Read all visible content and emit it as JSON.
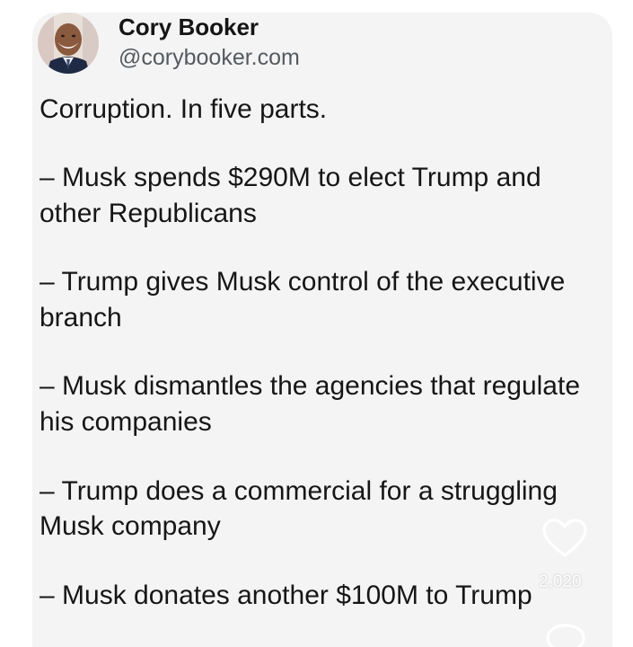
{
  "post": {
    "author_name": "Cory Booker",
    "author_handle": "@corybooker.com",
    "lines": [
      "Corruption. In five parts.",
      "– Musk spends $290M to elect Trump and",
      "other Republicans",
      "– Trump gives Musk control of the executive",
      "branch",
      "– Musk dismantles the agencies that regulate",
      "his companies",
      "– Trump does a commercial for a struggling",
      "Musk company",
      "– Musk donates another $100M to Trump"
    ]
  },
  "actions": {
    "like_icon": "heart-outline-icon",
    "like_count": "2,020",
    "comment_icon": "comment-bubble-icon"
  },
  "colors": {
    "card_background": "#f4f4f4",
    "text": "#161616",
    "handle": "#555a60"
  }
}
